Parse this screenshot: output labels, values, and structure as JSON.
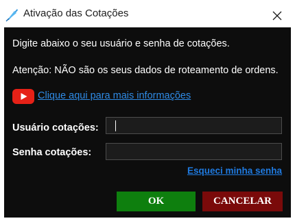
{
  "window": {
    "title": "Ativação das Cotações",
    "icon": "app-feather-icon",
    "close_icon": "close-icon"
  },
  "dialog": {
    "instruction": "Digite abaixo o seu usuário e senha de cotações.",
    "warning": "Atenção: NÃO são os seus dados de roteamento de ordens.",
    "info_link": "Clique aqui para mais informações",
    "info_icon": "youtube-icon"
  },
  "form": {
    "username_label": "Usuário cotações:",
    "username_value": "",
    "password_label": "Senha cotações:",
    "password_value": "",
    "forgot_password": "Esqueci minha senha"
  },
  "buttons": {
    "ok": "OK",
    "cancel": "CANCELAR"
  },
  "colors": {
    "background": "#0d0d0d",
    "ok_button": "#0e7f0e",
    "cancel_button": "#7a0a0a",
    "link": "#2f8be6"
  }
}
